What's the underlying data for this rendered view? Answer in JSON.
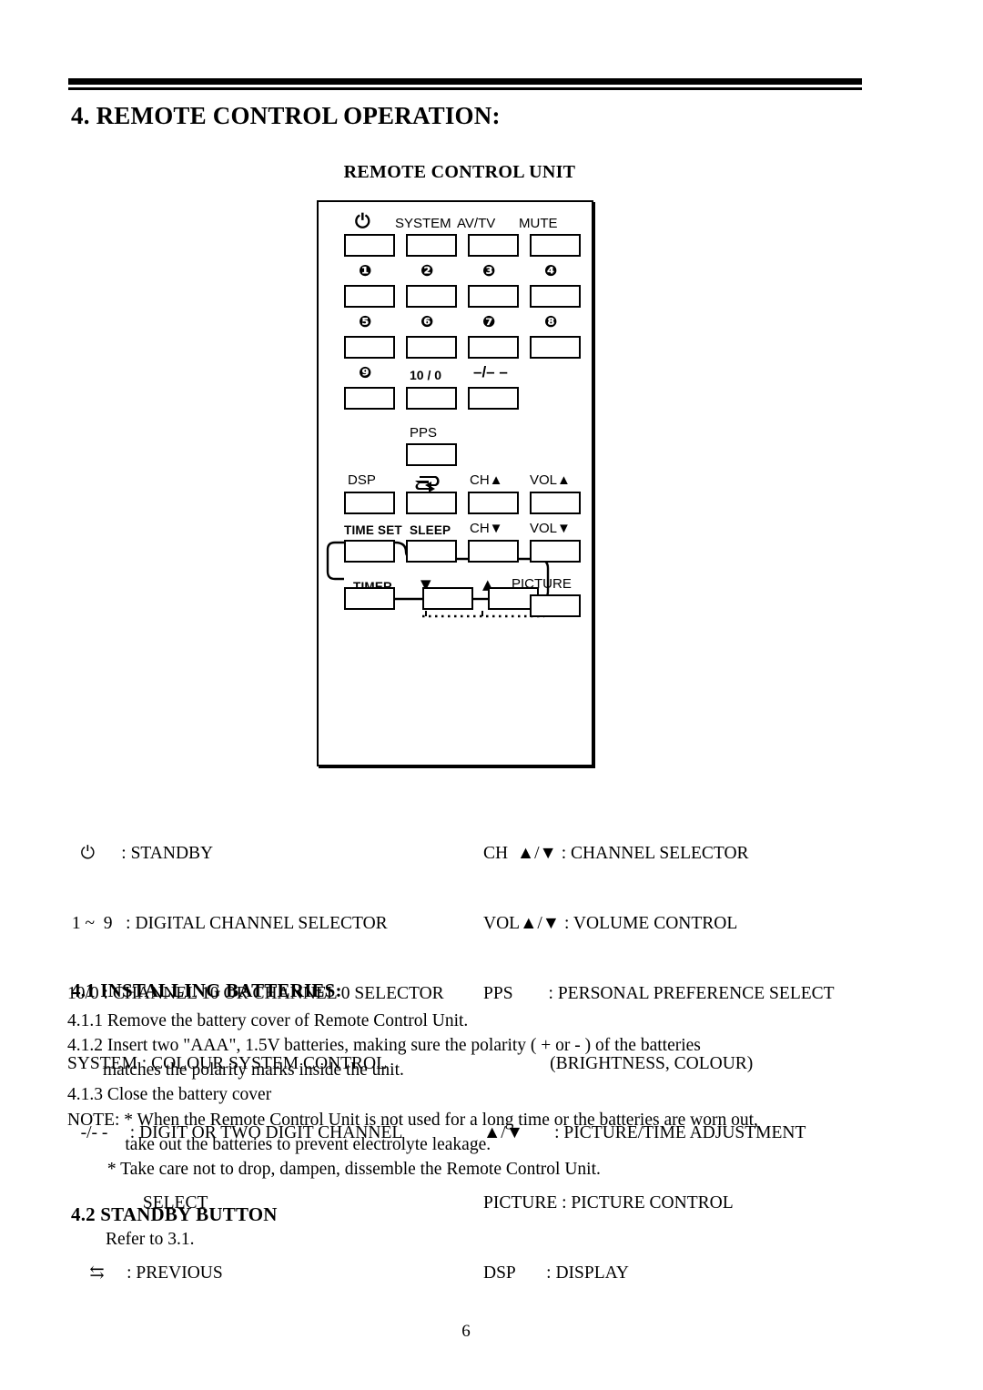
{
  "page": {
    "number": "6",
    "heading": "4. REMOTE CONTROL OPERATION:",
    "subheading": "REMOTE CONTROL UNIT"
  },
  "remote": {
    "labels": {
      "power": "⏻",
      "system": "SYSTEM",
      "avtv": "AV/TV",
      "mute": "MUTE",
      "n1": "❶",
      "n2": "❷",
      "n3": "❸",
      "n4": "❹",
      "n5": "❺",
      "n6": "❻",
      "n7": "❼",
      "n8": "❽",
      "n9": "❾",
      "ten_zero": "10 / 0",
      "dash_slash": "–/– –",
      "pps": "PPS",
      "dsp": "DSP",
      "previous": "previous-swap-icon",
      "ch_up": "CH▲",
      "vol_up": "VOL▲",
      "time_set": "TIME SET",
      "sleep": "SLEEP",
      "ch_down": "CH▼",
      "vol_down": "VOL▼",
      "timer": "TIMER",
      "down_arrow": "▼",
      "up_arrow": "▲",
      "picture": "PICTURE"
    }
  },
  "legend": {
    "left": [
      "   ⏻      : STANDBY",
      " 1 ~  9   : DIGITAL CHANNEL SELECTOR",
      "10/0 : CHANNEL 10 OR CHANNEL 0 SELECTOR",
      "SYSTEM : COLOUR SYSTEM CONTROL",
      "   -/- -     : DIGIT OR TWO DIGIT CHANNEL",
      "                 SELECT",
      "     ⇆     : PREVIOUS"
    ],
    "right": [
      "CH  ▲/▼ : CHANNEL SELECTOR",
      "VOL▲/▼ : VOLUME CONTROL",
      "PPS        : PERSONAL PREFERENCE SELECT",
      "               (BRIGHTNESS, COLOUR)",
      "▲/▼       : PICTURE/TIME ADJUSTMENT",
      "PICTURE : PICTURE CONTROL",
      "DSP       : DISPLAY"
    ]
  },
  "sections": {
    "batteries": {
      "heading": "4.1 INSTALLING BATTERIES:",
      "lines": [
        "4.1.1 Remove the battery cover of Remote Control Unit.",
        "4.1.2 Insert two \"AAA\", 1.5V batteries, making sure the polarity ( + or - ) of the batteries",
        "        matches the polarity marks inside the unit.",
        "4.1.3 Close the battery cover"
      ],
      "note": [
        "NOTE: * When the Remote Control Unit is not used for a long time or the batteries are worn out,",
        "             take out the batteries to prevent electrolyte leakage.",
        "         * Take care not to drop, dampen, dissemble the Remote Control Unit."
      ]
    },
    "standby": {
      "heading": "4.2 STANDBY BUTTON",
      "body": "Refer to 3.1."
    }
  }
}
